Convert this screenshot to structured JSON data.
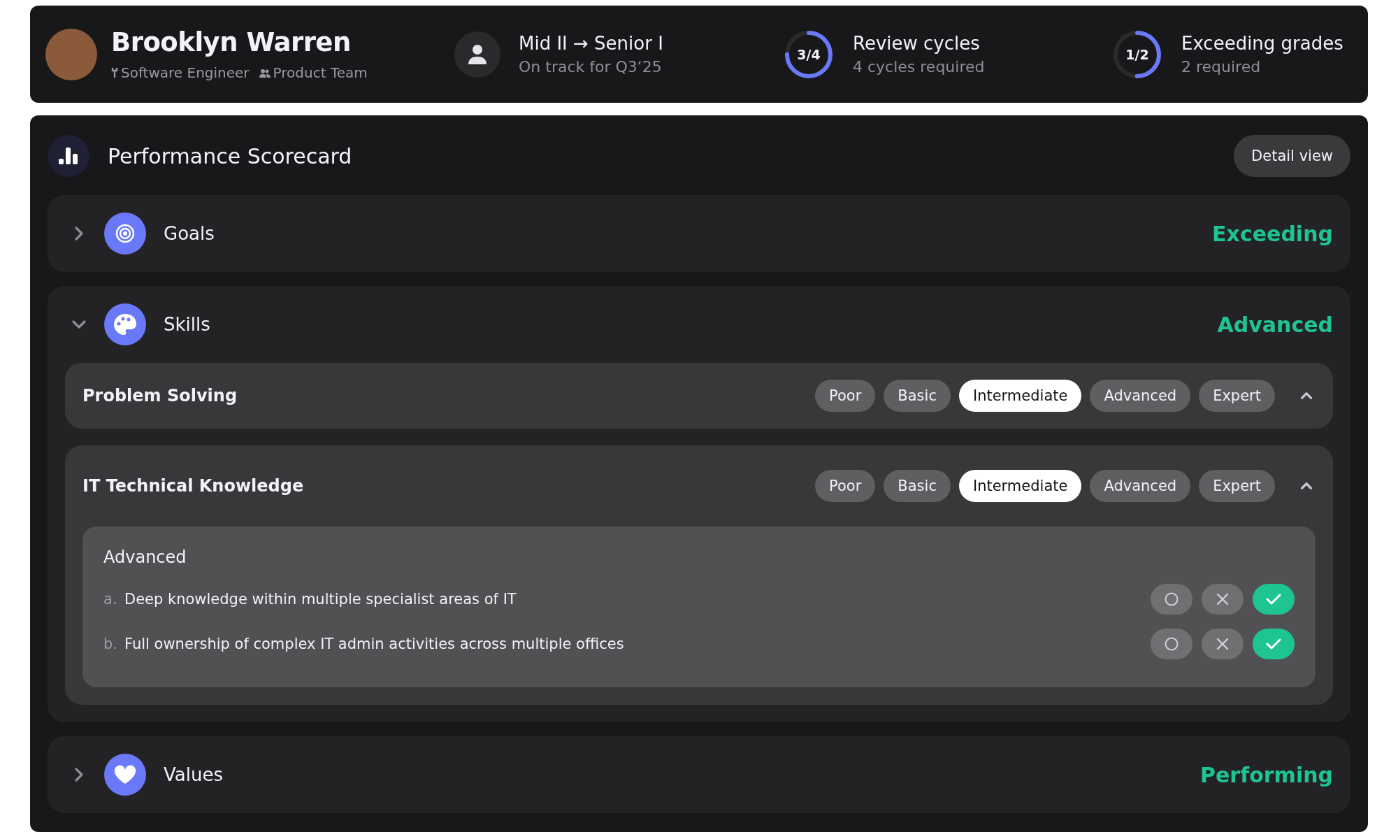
{
  "profile": {
    "name": "Brooklyn Warren",
    "role": "Software Engineer",
    "team": "Product Team"
  },
  "stats": [
    {
      "kind": "person",
      "title": "Mid II → Senior I",
      "subtitle": "On track for Q3‘25"
    },
    {
      "kind": "ring",
      "progress": "3/4",
      "level": 0.75,
      "title": "Review cycles",
      "subtitle": "4 cycles required"
    },
    {
      "kind": "ring",
      "progress": "1/2",
      "level": 0.5,
      "title": "Exceeding grades",
      "subtitle": "2 required"
    }
  ],
  "scorecard": {
    "title": "Performance Scorecard",
    "detail_button": "Detail view",
    "sections": [
      {
        "title": "Goals",
        "rating": "Exceeding",
        "expanded": false
      },
      {
        "title": "Skills",
        "rating": "Advanced",
        "expanded": true,
        "skills": [
          {
            "name": "Problem Solving",
            "expanded": true,
            "levels": [
              {
                "label": "Poor",
                "selected": false
              },
              {
                "label": "Basic",
                "selected": false
              },
              {
                "label": "Intermediate",
                "selected": true
              },
              {
                "label": "Advanced",
                "selected": false
              },
              {
                "label": "Expert",
                "selected": false
              }
            ]
          },
          {
            "name": "IT Technical Knowledge",
            "expanded": true,
            "levels": [
              {
                "label": "Poor",
                "selected": false
              },
              {
                "label": "Basic",
                "selected": false
              },
              {
                "label": "Intermediate",
                "selected": true
              },
              {
                "label": "Advanced",
                "selected": false
              },
              {
                "label": "Expert",
                "selected": false
              }
            ],
            "detail": {
              "title": "Advanced",
              "criteria": [
                {
                  "marker": "a.",
                  "text": "Deep knowledge within multiple specialist areas of IT",
                  "choices": [
                    {
                      "selected": false
                    },
                    {
                      "selected": false
                    },
                    {
                      "selected": true
                    }
                  ]
                },
                {
                  "marker": "b.",
                  "text": "Full ownership of complex IT admin activities across multiple offices",
                  "choices": [
                    {
                      "selected": false
                    },
                    {
                      "selected": false
                    },
                    {
                      "selected": true
                    }
                  ]
                }
              ]
            }
          }
        ]
      },
      {
        "title": "Values",
        "rating": "Performing",
        "expanded": false
      }
    ]
  }
}
